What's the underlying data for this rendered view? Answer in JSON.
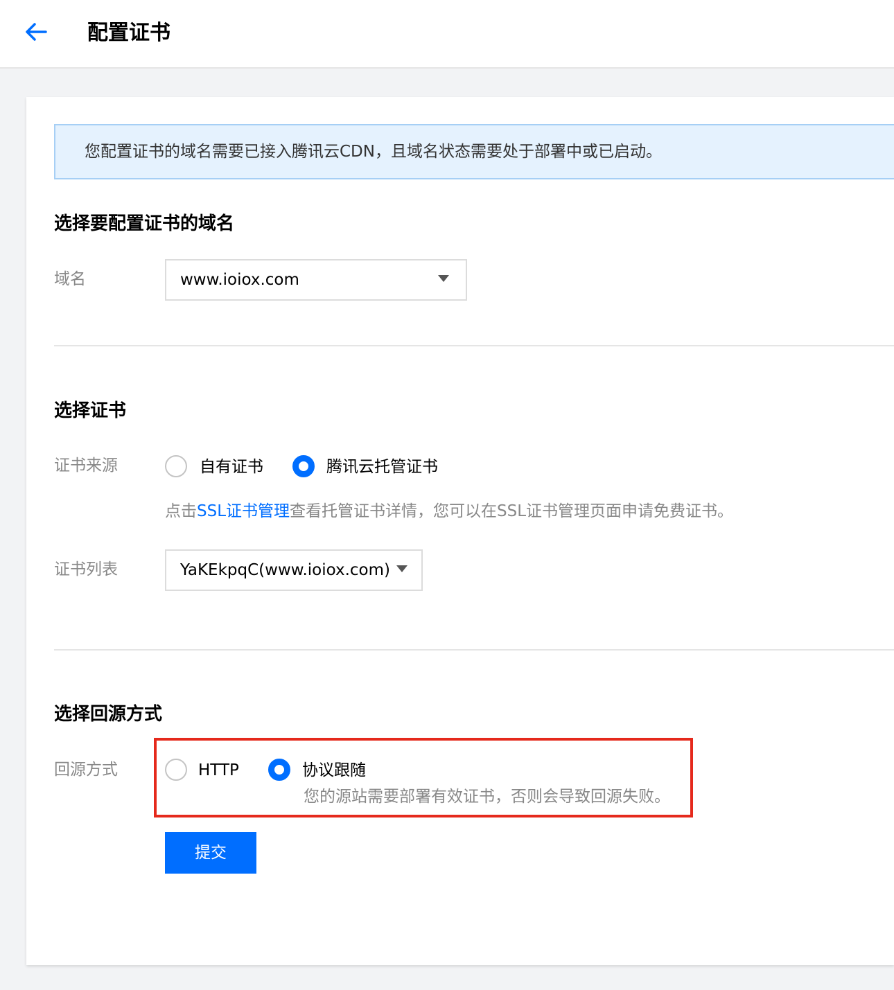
{
  "header": {
    "title": "配置证书"
  },
  "notice": {
    "text": "您配置证书的域名需要已接入腾讯云CDN，且域名状态需要处于部署中或已启动。"
  },
  "domain_section": {
    "title": "选择要配置证书的域名",
    "domain_label": "域名",
    "domain_value": "www.ioiox.com"
  },
  "cert_section": {
    "title": "选择证书",
    "source_label": "证书来源",
    "source_options": [
      {
        "label": "自有证书",
        "checked": false
      },
      {
        "label": "腾讯云托管证书",
        "checked": true
      }
    ],
    "help_prefix": "点击",
    "help_link": "SSL证书管理",
    "help_suffix": "查看托管证书详情，您可以在SSL证书管理页面申请免费证书。",
    "list_label": "证书列表",
    "list_value": "YaKEkpqC(www.ioiox.com)"
  },
  "origin_section": {
    "title": "选择回源方式",
    "method_label": "回源方式",
    "method_options": [
      {
        "label": "HTTP",
        "checked": false
      },
      {
        "label": "协议跟随",
        "checked": true
      }
    ],
    "method_help": "您的源站需要部署有效证书，否则会导致回源失败。"
  },
  "actions": {
    "submit_label": "提交"
  },
  "colors": {
    "primary": "#006eff",
    "highlight": "#e5291c",
    "notice_bg": "#e5f2fe"
  }
}
